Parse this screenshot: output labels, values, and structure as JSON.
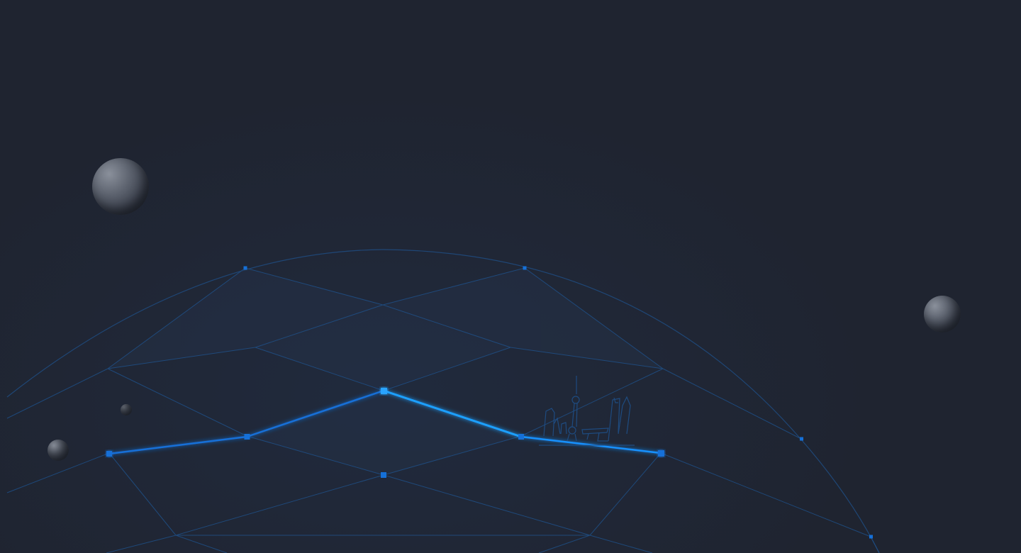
{
  "colors": {
    "background": "#1f2430",
    "grid_line": "#1f4f86",
    "highlight_line": "#1791ff",
    "node": "#1570d8",
    "node_bright": "#29a4ff",
    "skyline": "#1e4f88",
    "planet": "#6b717c"
  },
  "icons": {
    "skyline": "city-skyline-icon",
    "planet": "planet-icon"
  }
}
